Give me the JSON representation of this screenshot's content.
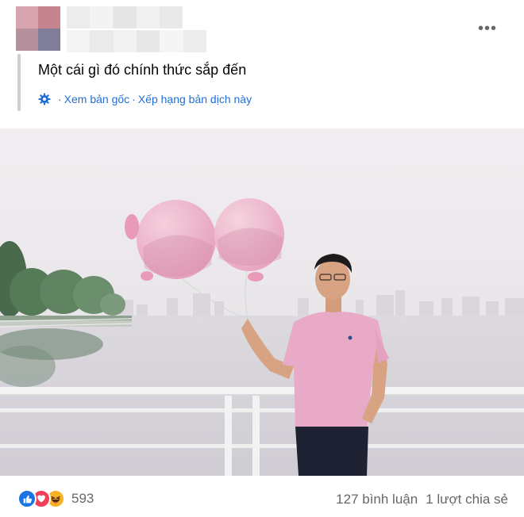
{
  "post": {
    "text": "Một cái gì đó chính thức sắp đến",
    "translation": {
      "view_original": "Xem bản gốc",
      "separator": "·",
      "rate_translation": "Xếp hạng bản dịch này"
    },
    "more_menu": "•••"
  },
  "footer": {
    "reaction_count": "593",
    "comments": "127 bình luận",
    "shares": "1 lượt chia sẻ"
  },
  "colors": {
    "link": "#216fdb",
    "like": "#1b74e4",
    "love": "#f33e58",
    "haha": "#f7b125",
    "secondary_text": "#65676b"
  },
  "icons": [
    "gear-icon",
    "like-reaction-icon",
    "love-reaction-icon",
    "haha-reaction-icon",
    "more-options-icon"
  ]
}
